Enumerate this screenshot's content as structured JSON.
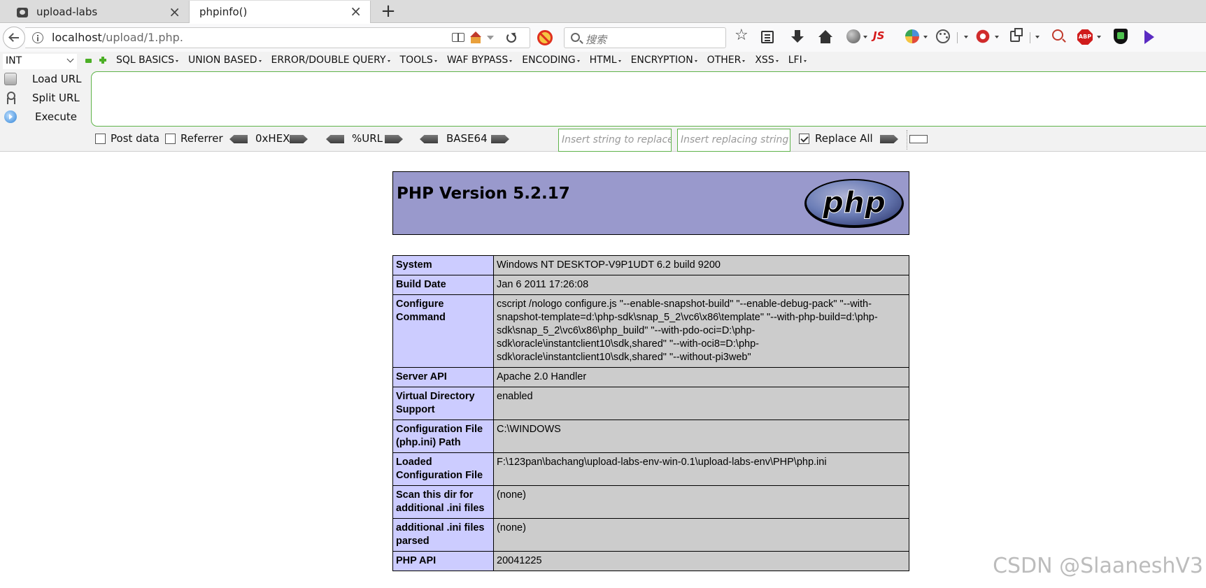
{
  "browser": {
    "tabs": [
      {
        "title": "upload-labs",
        "active": false
      },
      {
        "title": "phpinfo()",
        "active": true
      }
    ],
    "url_host": "localhost",
    "url_path": "/upload/1.php.",
    "search_placeholder": "搜索",
    "js_label": "JS",
    "abp_label": "ABP"
  },
  "hackbar": {
    "select_value": "INT",
    "menus": [
      "SQL BASICS",
      "UNION BASED",
      "ERROR/DOUBLE QUERY",
      "TOOLS",
      "WAF BYPASS",
      "ENCODING",
      "HTML",
      "ENCRYPTION",
      "OTHER",
      "XSS",
      "LFI"
    ],
    "actions": {
      "load": "Load URL",
      "split": "Split URL",
      "execute": "Execute"
    },
    "options": {
      "post_data": "Post data",
      "referrer": "Referrer",
      "hex": "0xHEX",
      "url": "%URL",
      "base64": "BASE64",
      "replace_placeholder": "Insert string to replace",
      "replacing_placeholder": "Insert replacing string",
      "replace_all": "Replace All"
    },
    "post_data_checked": false,
    "referrer_checked": false,
    "replace_all_checked": true
  },
  "phpinfo": {
    "version_title": "PHP Version 5.2.17",
    "logo_text": "php",
    "rows": [
      {
        "key": "System",
        "value": "Windows NT DESKTOP-V9P1UDT 6.2 build 9200"
      },
      {
        "key": "Build Date",
        "value": "Jan 6 2011 17:26:08"
      },
      {
        "key": "Configure Command",
        "value": "cscript /nologo configure.js \"--enable-snapshot-build\" \"--enable-debug-pack\" \"--with-snapshot-template=d:\\php-sdk\\snap_5_2\\vc6\\x86\\template\" \"--with-php-build=d:\\php-sdk\\snap_5_2\\vc6\\x86\\php_build\" \"--with-pdo-oci=D:\\php-sdk\\oracle\\instantclient10\\sdk,shared\" \"--with-oci8=D:\\php-sdk\\oracle\\instantclient10\\sdk,shared\" \"--without-pi3web\""
      },
      {
        "key": "Server API",
        "value": "Apache 2.0 Handler"
      },
      {
        "key": "Virtual Directory Support",
        "value": "enabled"
      },
      {
        "key": "Configuration File (php.ini) Path",
        "value": "C:\\WINDOWS"
      },
      {
        "key": "Loaded Configuration File",
        "value": "F:\\123pan\\bachang\\upload-labs-env-win-0.1\\upload-labs-env\\PHP\\php.ini"
      },
      {
        "key": "Scan this dir for additional .ini files",
        "value": "(none)"
      },
      {
        "key": "additional .ini files parsed",
        "value": "(none)"
      },
      {
        "key": "PHP API",
        "value": "20041225"
      }
    ]
  },
  "watermark": "CSDN @SlaaneshV3",
  "colors": {
    "php_header_bg": "#9999cc",
    "key_cell_bg": "#ccccff",
    "value_cell_bg": "#cccccc",
    "hackbar_green": "#5fb34a"
  }
}
